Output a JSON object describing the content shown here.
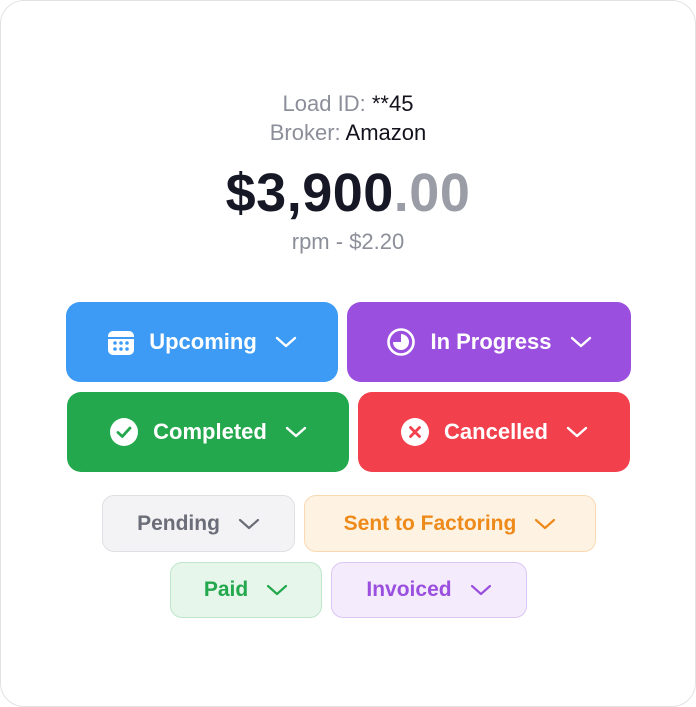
{
  "load": {
    "id_label": "Load ID:",
    "id_value": "**45",
    "broker_label": "Broker:",
    "broker_value": "Amazon"
  },
  "amount": {
    "whole": "$3,900",
    "cents": ".00"
  },
  "rpm": "rpm - $2.20",
  "status_buttons": [
    {
      "label": "Upcoming",
      "color": "#3d9bf5",
      "icon": "calendar-icon"
    },
    {
      "label": "In Progress",
      "color": "#9b4fdf",
      "icon": "progress-clock-icon"
    },
    {
      "label": "Completed",
      "color": "#24a84d",
      "icon": "check-circle-icon"
    },
    {
      "label": "Cancelled",
      "color": "#f2404c",
      "icon": "x-circle-icon"
    }
  ],
  "payment_pills": [
    {
      "label": "Pending",
      "text_color": "#6b6e78",
      "bg": "#f3f3f5",
      "border": "#e0e0e4",
      "icon": "chevron-down-icon"
    },
    {
      "label": "Sent to Factoring",
      "text_color": "#ee8a1a",
      "bg": "#fef2e3",
      "border": "#f8d9b2",
      "icon": "chevron-down-icon"
    },
    {
      "label": "Paid",
      "text_color": "#24a84d",
      "bg": "#e6f6ea",
      "border": "#bfe6cb",
      "icon": "chevron-down-icon"
    },
    {
      "label": "Invoiced",
      "text_color": "#9b4fdf",
      "bg": "#f4ecfc",
      "border": "#dcc6f4",
      "icon": "chevron-down-icon"
    }
  ]
}
